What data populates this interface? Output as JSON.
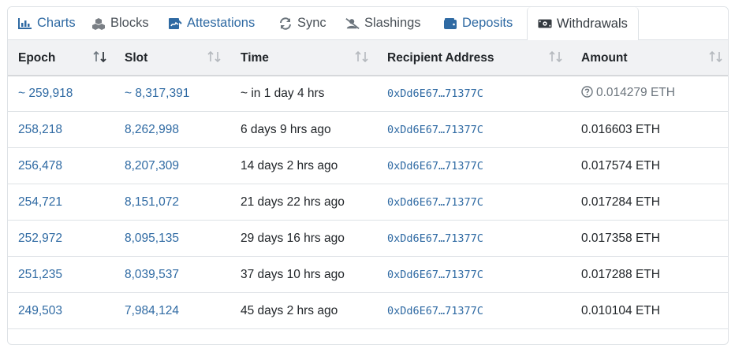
{
  "tabs": [
    {
      "label": "Charts",
      "icon": "bar-chart-icon"
    },
    {
      "label": "Blocks",
      "icon": "cubes-icon"
    },
    {
      "label": "Attestations",
      "icon": "signature-icon"
    },
    {
      "label": "Sync",
      "icon": "sync-icon"
    },
    {
      "label": "Slashings",
      "icon": "user-slash-icon"
    },
    {
      "label": "Deposits",
      "icon": "wallet-icon"
    },
    {
      "label": "Withdrawals",
      "icon": "money-bill-icon"
    }
  ],
  "active_tab": "Withdrawals",
  "table": {
    "columns": [
      "Epoch",
      "Slot",
      "Time",
      "Recipient Address",
      "Amount"
    ],
    "rows": [
      {
        "epoch": "~ 259,918",
        "slot": "~ 8,317,391",
        "time": "~ in 1 day 4 hrs",
        "address": "0xDd6E67…71377C",
        "amount": "0.014279 ETH",
        "pending": true
      },
      {
        "epoch": "258,218",
        "slot": "8,262,998",
        "time": "6 days 9 hrs ago",
        "address": "0xDd6E67…71377C",
        "amount": "0.016603 ETH",
        "pending": false
      },
      {
        "epoch": "256,478",
        "slot": "8,207,309",
        "time": "14 days 2 hrs ago",
        "address": "0xDd6E67…71377C",
        "amount": "0.017574 ETH",
        "pending": false
      },
      {
        "epoch": "254,721",
        "slot": "8,151,072",
        "time": "21 days 22 hrs ago",
        "address": "0xDd6E67…71377C",
        "amount": "0.017284 ETH",
        "pending": false
      },
      {
        "epoch": "252,972",
        "slot": "8,095,135",
        "time": "29 days 16 hrs ago",
        "address": "0xDd6E67…71377C",
        "amount": "0.017358 ETH",
        "pending": false
      },
      {
        "epoch": "251,235",
        "slot": "8,039,537",
        "time": "37 days 10 hrs ago",
        "address": "0xDd6E67…71377C",
        "amount": "0.017288 ETH",
        "pending": false
      },
      {
        "epoch": "249,503",
        "slot": "7,984,124",
        "time": "45 days 2 hrs ago",
        "address": "0xDd6E67…71377C",
        "amount": "0.010104 ETH",
        "pending": false
      }
    ]
  },
  "colors": {
    "link": "#2f6aa3",
    "header_bg": "#f1f2f4",
    "border": "#dee2e6"
  }
}
